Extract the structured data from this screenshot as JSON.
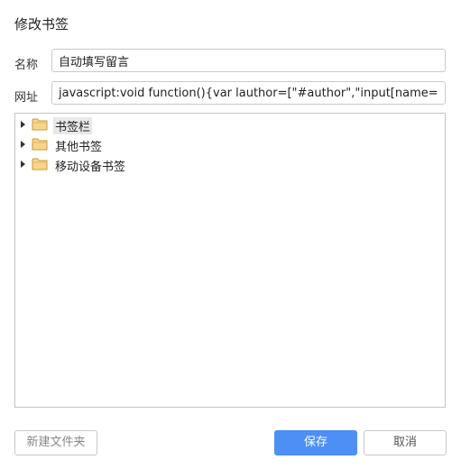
{
  "dialog": {
    "title": "修改书签",
    "name_label": "名称",
    "name_value": "自动填写留言",
    "url_label": "网址",
    "url_value": "javascript:void function(){var lauthor=[\"#author\",\"input[name='comname'"
  },
  "tree": {
    "items": [
      {
        "label": "书签栏",
        "icon": "folder-icon",
        "selected": true
      },
      {
        "label": "其他书签",
        "icon": "folder-icon",
        "selected": false
      },
      {
        "label": "移动设备书签",
        "icon": "folder-icon",
        "selected": false
      }
    ]
  },
  "buttons": {
    "new_folder": "新建文件夹",
    "save": "保存",
    "cancel": "取消"
  },
  "colors": {
    "accent": "#4d8ff5",
    "folder_fill": "#f7d58a",
    "folder_stroke": "#c79a3a"
  }
}
